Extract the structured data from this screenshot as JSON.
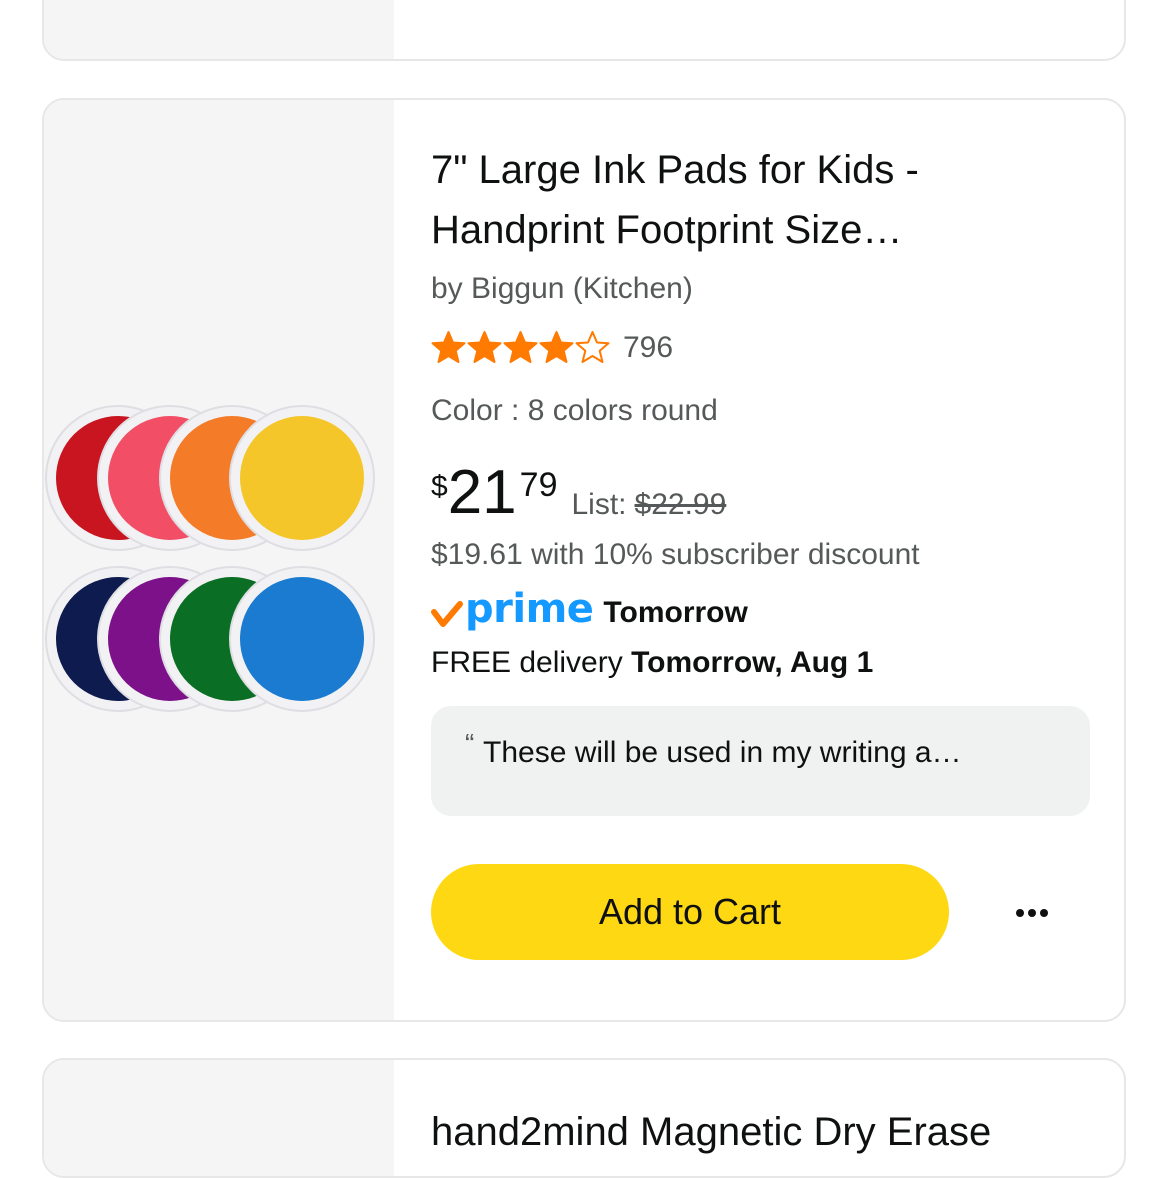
{
  "previous_product": {},
  "product": {
    "title": "7\" Large Ink Pads for Kids - Handprint Footprint Size…",
    "brand": "by Biggun (Kitchen)",
    "rating": 4.5,
    "review_count": "796",
    "color": "Color : 8 colors round",
    "price": {
      "currency": "$",
      "whole": "21",
      "fraction": "79",
      "list_label": "List:",
      "list_price": "$22.99"
    },
    "subscriber_discount": "$19.61 with 10% subscriber discount",
    "prime": {
      "word": "prime",
      "delivery_speed": "Tomorrow"
    },
    "delivery": {
      "prefix": "FREE delivery",
      "date": "Tomorrow, Aug 1"
    },
    "review_quote": "These will be used in my writing a…",
    "add_to_cart_label": "Add to Cart",
    "more_options_icon": "ellipsis-icon",
    "ink_pad_colors": [
      "#c8151f",
      "#f24e66",
      "#f47b27",
      "#f5c62a",
      "#0d1b4f",
      "#7c118a",
      "#0a6e24",
      "#1a7bd0"
    ]
  },
  "next_product": {
    "title": "hand2mind Magnetic Dry Erase"
  },
  "colors": {
    "star": "#ff7a00",
    "button": "#ffd814",
    "prime_blue": "#1399ff",
    "prime_check": "#ff7a00"
  }
}
